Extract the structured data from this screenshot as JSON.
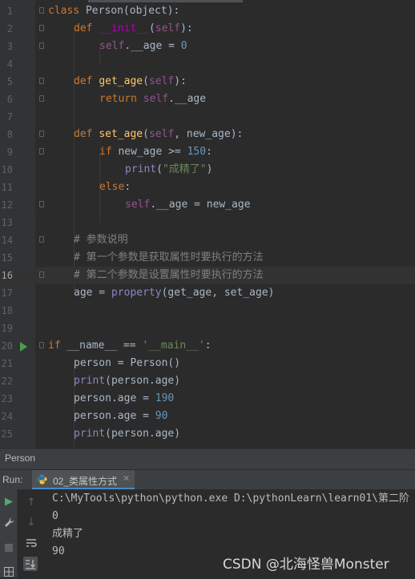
{
  "editor": {
    "lines": [
      {
        "num": "1"
      },
      {
        "num": "2"
      },
      {
        "num": "3"
      },
      {
        "num": "4"
      },
      {
        "num": "5"
      },
      {
        "num": "6"
      },
      {
        "num": "7"
      },
      {
        "num": "8"
      },
      {
        "num": "9"
      },
      {
        "num": "10"
      },
      {
        "num": "11"
      },
      {
        "num": "12"
      },
      {
        "num": "13"
      },
      {
        "num": "14"
      },
      {
        "num": "15"
      },
      {
        "num": "16"
      },
      {
        "num": "17"
      },
      {
        "num": "18"
      },
      {
        "num": "19"
      },
      {
        "num": "20"
      },
      {
        "num": "21"
      },
      {
        "num": "22"
      },
      {
        "num": "23"
      },
      {
        "num": "24"
      },
      {
        "num": "25"
      }
    ],
    "current_line": "16",
    "tokens": {
      "l1": [
        "class",
        " Person(object):"
      ],
      "l2": [
        "def",
        " ",
        "__init__",
        "(",
        "self",
        "):"
      ],
      "l3": [
        "self",
        ".__age = ",
        "0"
      ],
      "l5": [
        "def",
        " ",
        "get_age",
        "(",
        "self",
        "):"
      ],
      "l6": [
        "return",
        " ",
        "self",
        ".__age"
      ],
      "l8": [
        "def",
        " ",
        "set_age",
        "(",
        "self",
        ", new_age):"
      ],
      "l9": [
        "if",
        " new_age >= ",
        "150",
        ":"
      ],
      "l10": [
        "print",
        "(",
        "\"成精了\"",
        ")"
      ],
      "l11": [
        "else",
        ":"
      ],
      "l12": [
        "self",
        ".__age = new_age"
      ],
      "l14": "# 参数说明",
      "l15": "# 第一个参数是获取属性时要执行的方法",
      "l16": "# 第二个参数是设置属性时要执行的方法",
      "l17": [
        "age = ",
        "property",
        "(get_age, set_age)"
      ],
      "l20": [
        "if",
        " __name__ == ",
        "'__main__'",
        ":"
      ],
      "l21": "person = Person()",
      "l22": [
        "print",
        "(person.age)"
      ],
      "l23": [
        "person.age = ",
        "190"
      ],
      "l24": [
        "person.age = ",
        "90"
      ],
      "l25": [
        "print",
        "(person.age)"
      ]
    }
  },
  "breadcrumb": {
    "text": "Person"
  },
  "run": {
    "label": "Run:",
    "tab_label": "02_类属性方式",
    "console": [
      "C:\\MyTools\\python\\python.exe D:\\pythonLearn\\learn01\\第二阶",
      "0",
      "成精了",
      "90"
    ]
  },
  "watermark": "CSDN @北海怪兽Monster",
  "icons": {
    "run_gutter": "run-arrow-icon",
    "tab": "python-file-icon",
    "close": "close-icon",
    "tools": [
      "rerun-icon",
      "wrench-icon",
      "stop-icon",
      "layout-icon",
      "up-arrow-icon",
      "down-arrow-icon",
      "soft-wrap-icon",
      "scroll-to-end-icon"
    ]
  },
  "colors": {
    "keyword": "#cc7832",
    "function": "#ffc66d",
    "self": "#94558d",
    "number": "#6897bb",
    "string": "#6a8759",
    "comment": "#808080",
    "builtin": "#8888c6",
    "magic": "#b200b2"
  }
}
